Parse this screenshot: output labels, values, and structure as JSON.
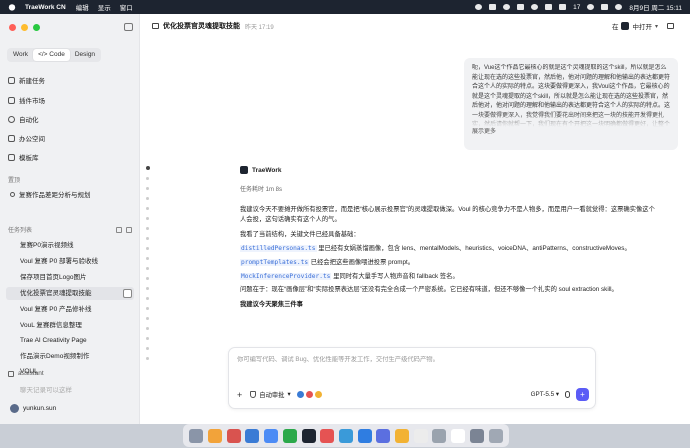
{
  "menubar": {
    "app_name": "TraeWork CN",
    "menus": [
      "编辑",
      "显示",
      "窗口"
    ],
    "battery": "17",
    "datetime": "8月9日 周二 15:11"
  },
  "sidebar": {
    "modes": [
      "Work",
      "</> Code",
      "Design"
    ],
    "active_mode": 1,
    "nav": [
      {
        "label": "新建任务",
        "icon": "new-task-icon"
      },
      {
        "label": "插件市场",
        "icon": "plugin-icon"
      },
      {
        "label": "自动化",
        "icon": "automation-icon"
      },
      {
        "label": "办公空间",
        "icon": "workspace-icon"
      },
      {
        "label": "模板库",
        "icon": "template-icon"
      }
    ],
    "pinned_label": "置顶",
    "pinned_item": "复赛作品差距分析与规划",
    "tasks_label": "任务列表",
    "tasks": [
      "复赛P0演示视频线",
      "Voul 复赛 P0 部署与验收线",
      "保存项目首页Logo图片",
      "优化投票官灵魂提取技能",
      "Voul 复赛 P0 产品修补线",
      "VouL 复赛群信息整理",
      "Trae AI Creativity Page",
      "作品演示Demo视频制作",
      "VOUL"
    ],
    "active_task": 3,
    "assistant_label": "assistant",
    "assistant_next": "聊天记录可以这样",
    "user_name": "yunkun.sun"
  },
  "header": {
    "title": "优化投票官灵魂提取技能",
    "date": "昨天 17:19",
    "open_in_label": "在",
    "open_target": "中打开"
  },
  "user_message": {
    "text": "呃，Vue这个作品它最核心的就是这个灵魂提取的这个skill，所以就是怎么能让现在选的这些投票官，然后他，他对问题的理解和他输出的表达都更符合这个人的实际的特点。这块要做得更深入，我Voul这个作品，它最核心的就是这个灵魂提取的这个skill，所以就是怎么能让现在选的这些投票官，然后他对，他对问题的理解和他输出的表达都更符合这个人的实际的特点。这一块要做得更深入，我觉得我们要花出时间来把这一块的技能开发得更扎实，然后请你就帮一下，我们现在有个开把这一块明确都做得更好，让整个",
    "more_label": "展示更多"
  },
  "agent": {
    "name": "TraeWork",
    "elapsed": "任务耗时 1m 8s",
    "p1": "我建议今天不要摊开做所有投票官，而是把“核心展示投票官”的灵魂提取做深。Voul 的核心竞争力不是人物多，而是用户一看就觉得：这票确实像这个人会投，这句话确实有这个人的气。",
    "p2": "我看了当前结构，关键文件已经具备基础：",
    "items": [
      {
        "code": "distilledPersonas.ts",
        "text": " 里已经有女娲蒸馏画像，包含 lens、mentalModels、heuristics、voiceDNA、antiPatterns、constructiveMoves。"
      },
      {
        "code": "promptTemplates.ts",
        "text": " 已经会把这些画像喂进投票 prompt。"
      },
      {
        "code": "MockInferenceProvider.ts",
        "text": " 里同时有大量手写人物声音和 fallback 签名。"
      }
    ],
    "p3": "问题在于：现在“画像层”和“实际投票表达层”还没有完全合成一个严密系统。它已经有味道，但还不够像一个扎实的 soul extraction skill。",
    "bold": "我建议今天聚焦三件事"
  },
  "composer": {
    "placeholder": "你可编写代码、调试 Bug、优化性能等开发工作，交付生产级代码产物。",
    "approval_label": "自动审批",
    "model": "GPT-5.5"
  },
  "dock": {
    "colors": [
      "#8a95a8",
      "#f2a33a",
      "#d9534f",
      "#3a7bd5",
      "#4c8bf5",
      "#2ba84a",
      "#1d2430",
      "#e55353",
      "#3a9ad9",
      "#2f7de1",
      "#5b6fe0",
      "#f2b233",
      "#ececec",
      "#9aa3ae",
      "#ffffff",
      "#7b8494",
      "#a0a8b4"
    ]
  }
}
